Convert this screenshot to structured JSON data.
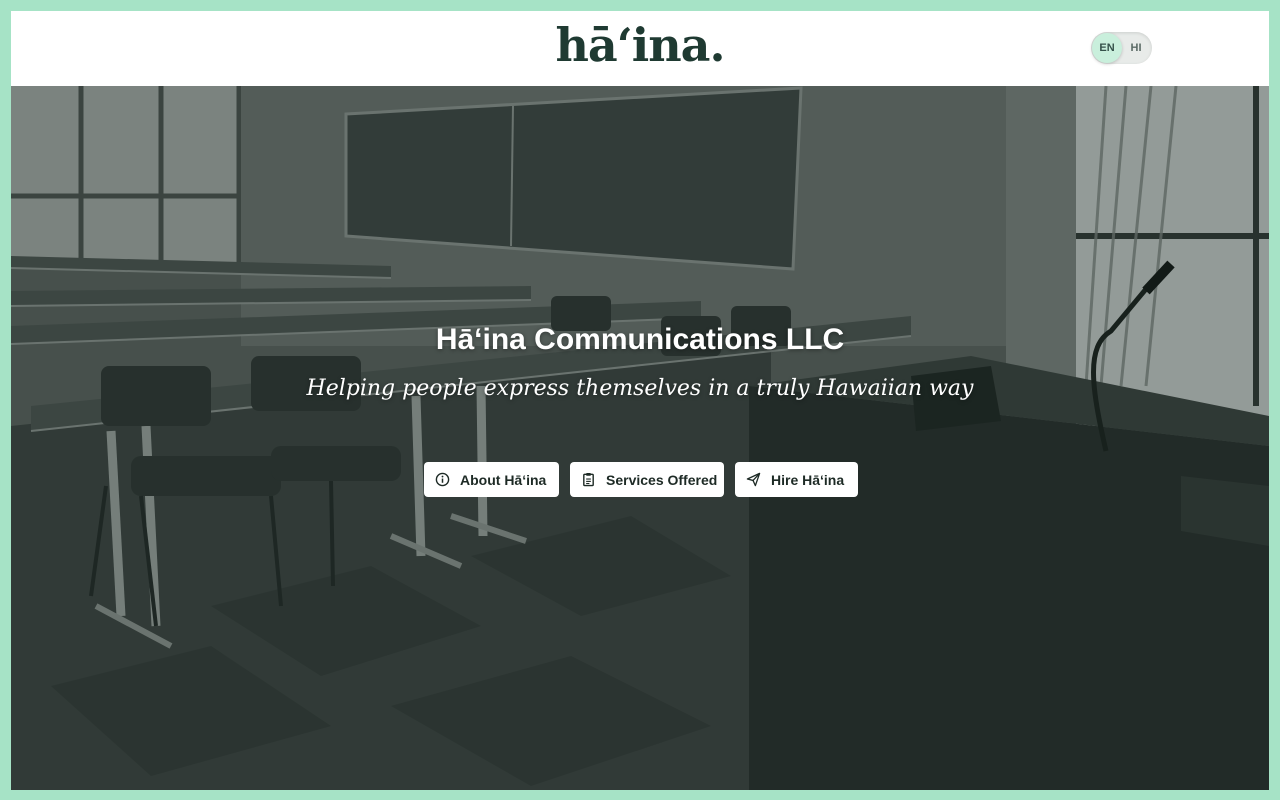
{
  "header": {
    "logo_text": "hāʻina.",
    "language_toggle": {
      "options": [
        "EN",
        "HI"
      ],
      "selected": "EN"
    }
  },
  "hero": {
    "title": "Hāʻina Communications LLC",
    "subtitle": "Helping people express themselves in a truly Hawaiian way",
    "buttons": [
      {
        "label": "About Hāʻina",
        "icon": "info-icon"
      },
      {
        "label": "Services Offered",
        "icon": "clipboard-icon"
      },
      {
        "label": "Hire Hāʻina",
        "icon": "paper-plane-icon"
      }
    ]
  },
  "colors": {
    "page_border": "#a6e3c6",
    "logo": "#1f3a32",
    "toggle_knob": "#c9efdc"
  }
}
